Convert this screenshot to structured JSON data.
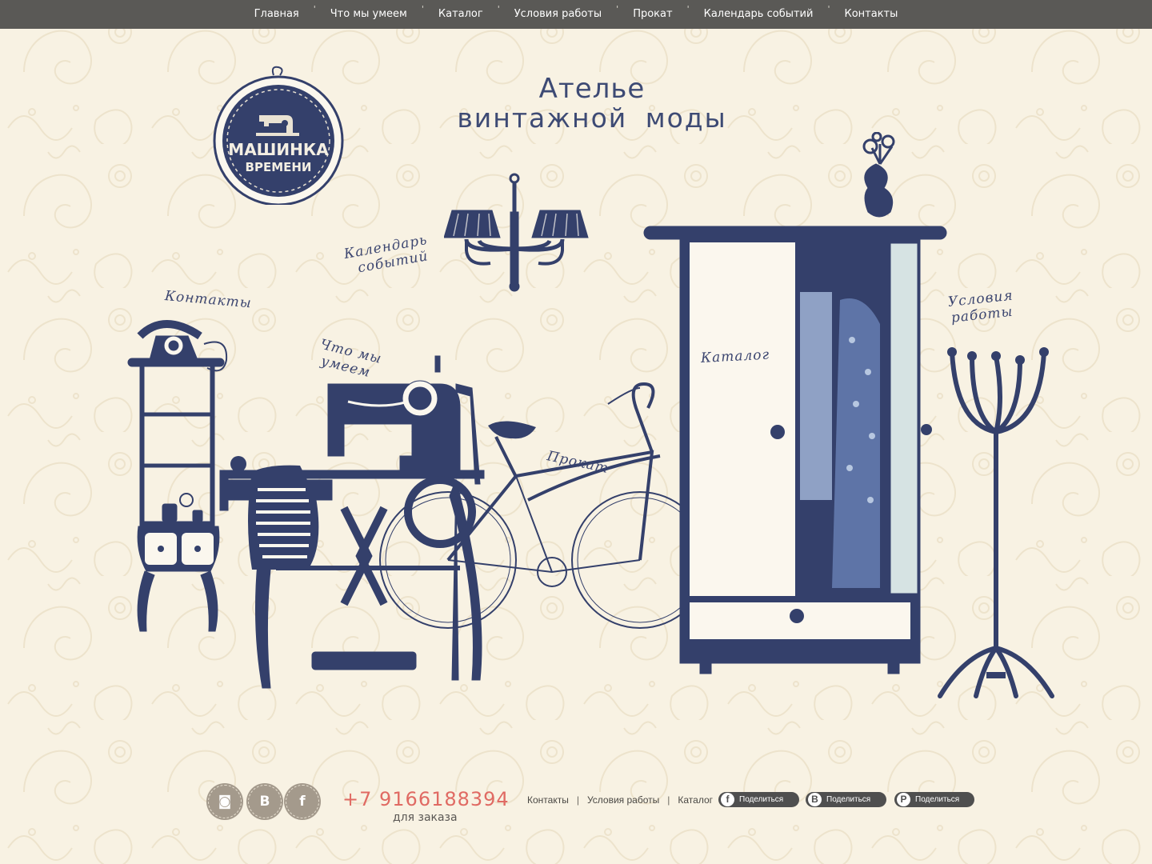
{
  "nav": {
    "items": [
      {
        "label": "Главная"
      },
      {
        "label": "Что мы умеем"
      },
      {
        "label": "Каталог"
      },
      {
        "label": "Условия работы"
      },
      {
        "label": "Прокат"
      },
      {
        "label": "Календарь событий"
      },
      {
        "label": "Контакты"
      }
    ],
    "separator": "'"
  },
  "logo": {
    "line1": "МАШИНКА",
    "line2": "ВРЕМЕНИ"
  },
  "title": {
    "line1": "Ателье",
    "line2": "винтажной моды"
  },
  "scene_labels": {
    "calendar_line1": "Календарь",
    "calendar_line2": "событий",
    "contacts": "Контакты",
    "skills_line1": "Что мы",
    "skills_line2": "умеем",
    "rental": "Прокат",
    "catalog": "Каталог",
    "terms_line1": "Условия",
    "terms_line2": "работы"
  },
  "footer": {
    "social": [
      {
        "icon": "instagram-icon",
        "glyph": "◙"
      },
      {
        "icon": "vk-icon",
        "glyph": "B"
      },
      {
        "icon": "facebook-icon",
        "glyph": "f"
      }
    ],
    "phone": "+7 9166188394",
    "phone_note": "для заказа",
    "links": [
      "Контакты",
      "Условия работы",
      "Каталог"
    ],
    "share": [
      {
        "icon": "facebook-icon",
        "glyph": "f",
        "label": "Поделиться"
      },
      {
        "icon": "vk-icon",
        "glyph": "B",
        "label": "Поделиться"
      },
      {
        "icon": "pinterest-icon",
        "glyph": "P",
        "label": "Поделиться"
      }
    ]
  },
  "colors": {
    "background": "#f8f2e3",
    "navbar": "#5a5956",
    "ink": "#34406b",
    "phone": "#e06a63",
    "share_button": "#4f4f4f"
  }
}
